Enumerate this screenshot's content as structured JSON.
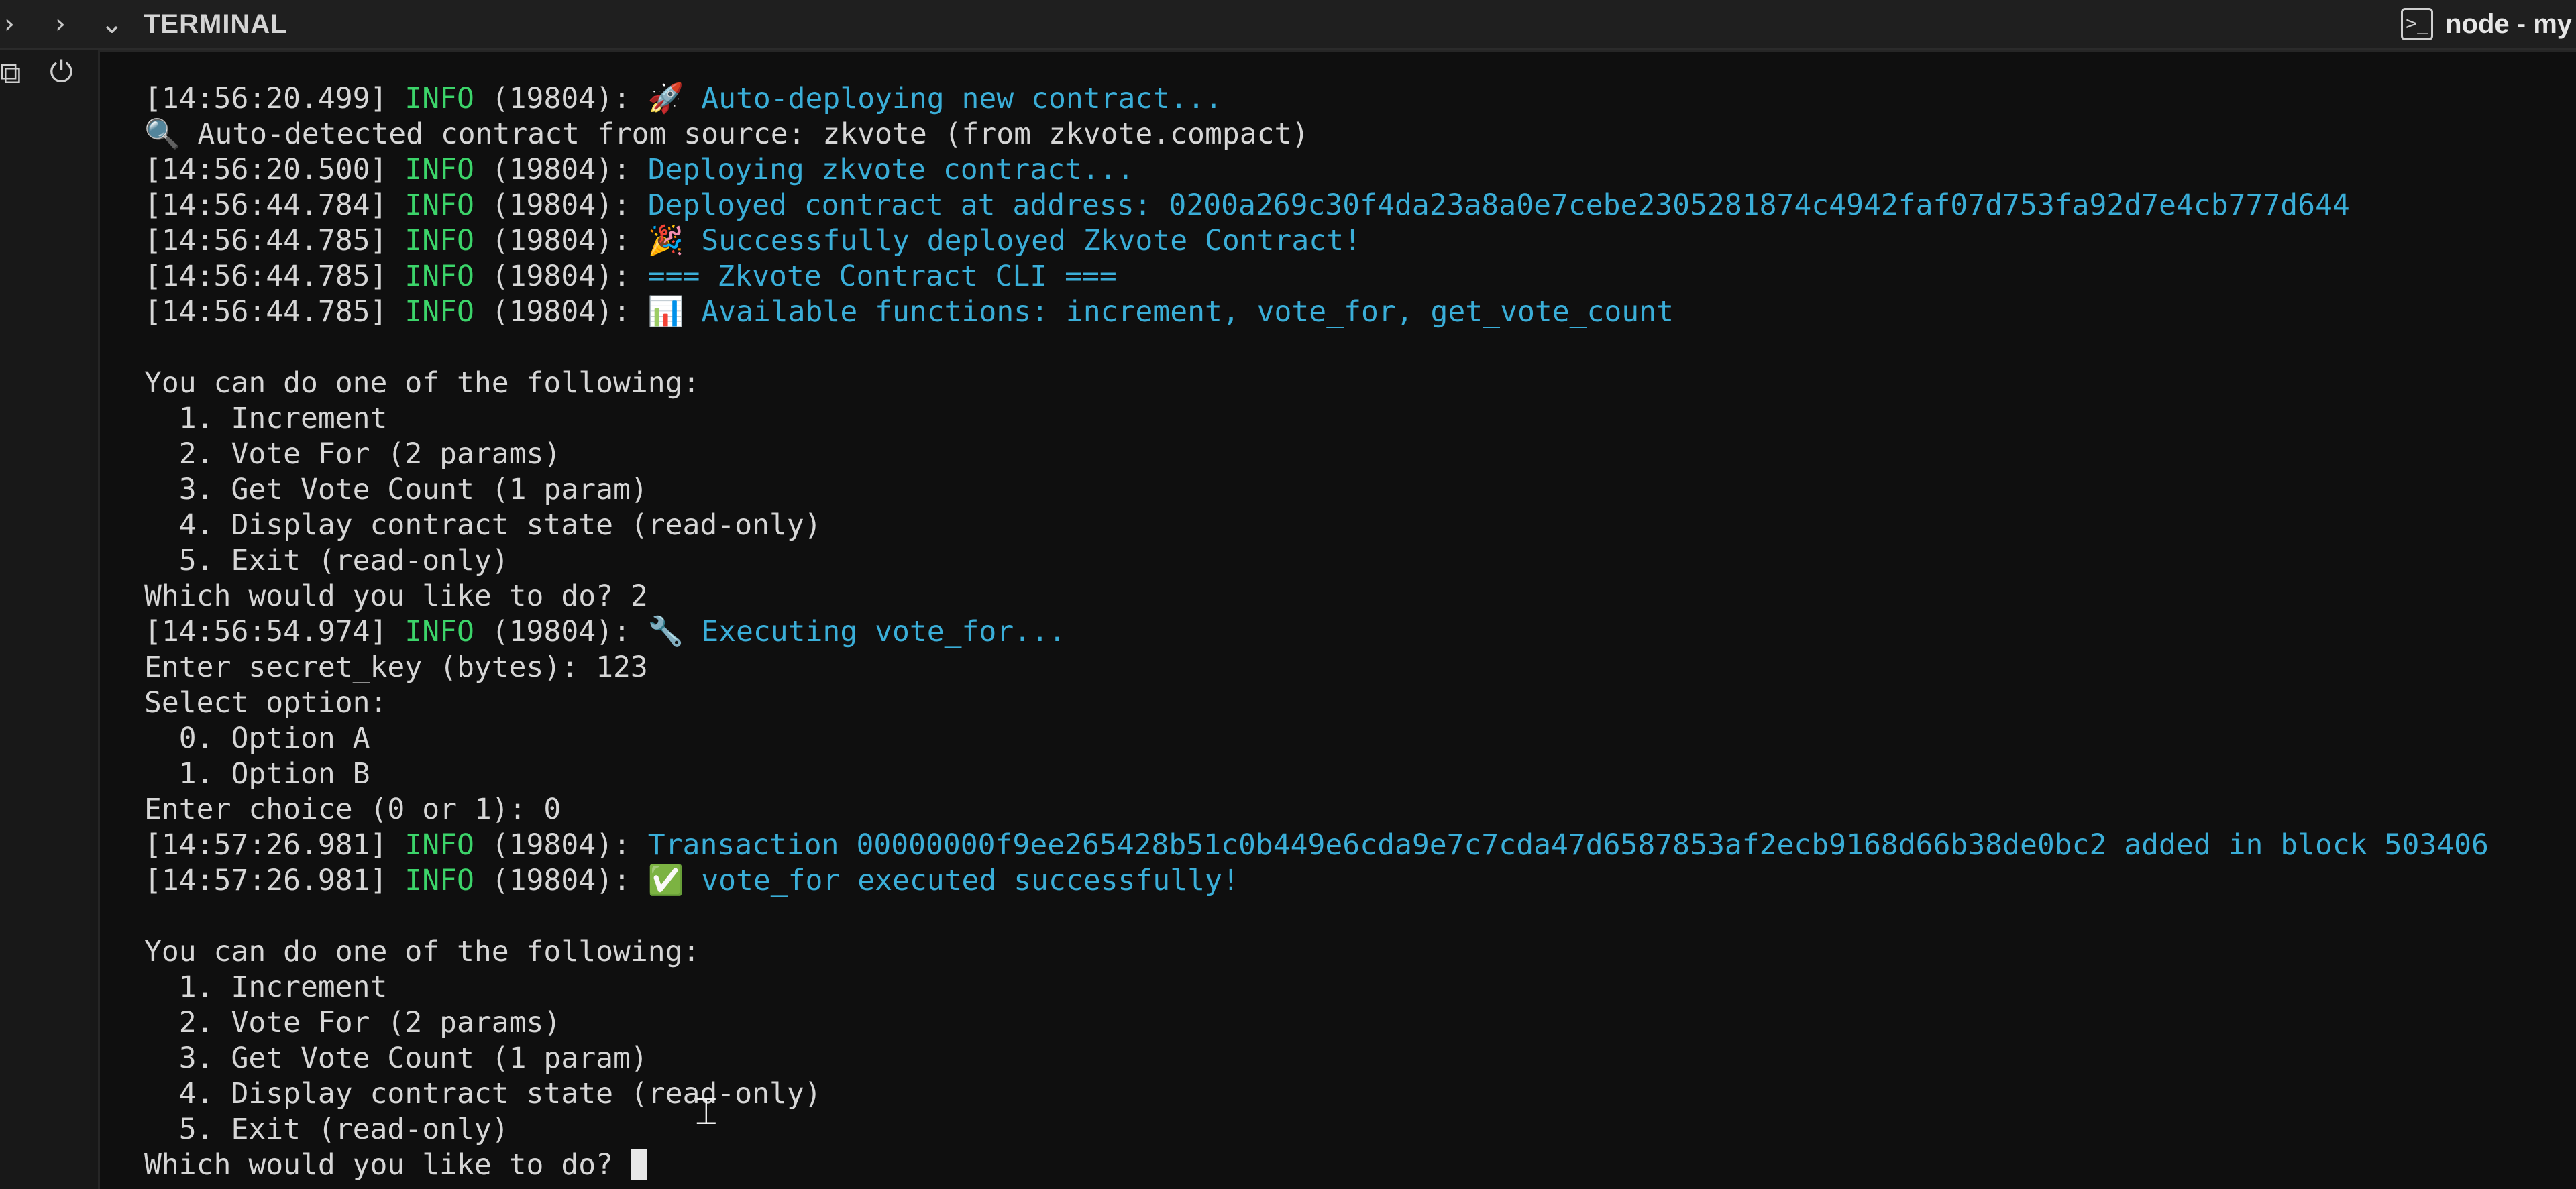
{
  "header": {
    "panel_title": "TERMINAL",
    "collapse_icon_1": "chevron-right-icon",
    "collapse_icon_2": "chevron-right-icon",
    "panel_toggle_icon": "chevron-down-icon",
    "tab": {
      "icon": "terminal-icon",
      "label": "node - my"
    }
  },
  "sidebar": {
    "icons": [
      "remote-explorer-icon",
      "plug-icon"
    ]
  },
  "colors": {
    "log_level": "#3cd46a",
    "log_message": "#3aaed8",
    "default_text": "#d6d6d6",
    "background": "#0f0f0f"
  },
  "terminal": {
    "lines": [
      {
        "ts": "[14:56:20.499]",
        "level": "INFO",
        "pid": "(19804):",
        "emoji": "🚀",
        "message": "Auto-deploying new contract..."
      },
      {
        "plain": "🔍 Auto-detected contract from source: zkvote (from zkvote.compact)"
      },
      {
        "ts": "[14:56:20.500]",
        "level": "INFO",
        "pid": "(19804):",
        "message": "Deploying zkvote contract..."
      },
      {
        "ts": "[14:56:44.784]",
        "level": "INFO",
        "pid": "(19804):",
        "message": "Deployed contract at address: 0200a269c30f4da23a8a0e7cebe2305281874c4942faf07d753fa92d7e4cb777d644"
      },
      {
        "ts": "[14:56:44.785]",
        "level": "INFO",
        "pid": "(19804):",
        "emoji": "🎉",
        "message": "Successfully deployed Zkvote Contract!"
      },
      {
        "ts": "[14:56:44.785]",
        "level": "INFO",
        "pid": "(19804):",
        "message": "=== Zkvote Contract CLI ==="
      },
      {
        "ts": "[14:56:44.785]",
        "level": "INFO",
        "pid": "(19804):",
        "emoji": "📊",
        "message": "Available functions: increment, vote_for, get_vote_count"
      },
      {
        "plain": ""
      },
      {
        "plain": "You can do one of the following:"
      },
      {
        "plain": "  1. Increment"
      },
      {
        "plain": "  2. Vote For (2 params)"
      },
      {
        "plain": "  3. Get Vote Count (1 param)"
      },
      {
        "plain": "  4. Display contract state (read-only)"
      },
      {
        "plain": "  5. Exit (read-only)"
      },
      {
        "plain": "Which would you like to do? 2"
      },
      {
        "ts": "[14:56:54.974]",
        "level": "INFO",
        "pid": "(19804):",
        "emoji": "🔧",
        "message": "Executing vote_for..."
      },
      {
        "plain": "Enter secret_key (bytes): 123"
      },
      {
        "plain": "Select option:"
      },
      {
        "plain": "  0. Option A"
      },
      {
        "plain": "  1. Option B"
      },
      {
        "plain": "Enter choice (0 or 1): 0"
      },
      {
        "ts": "[14:57:26.981]",
        "level": "INFO",
        "pid": "(19804):",
        "message": "Transaction 00000000f9ee265428b51c0b449e6cda9e7c7cda47d6587853af2ecb9168d66b38de0bc2 added in block 503406"
      },
      {
        "ts": "[14:57:26.981]",
        "level": "INFO",
        "pid": "(19804):",
        "emoji": "✅",
        "message": "vote_for executed successfully!"
      },
      {
        "plain": ""
      },
      {
        "plain": "You can do one of the following:"
      },
      {
        "plain": "  1. Increment"
      },
      {
        "plain": "  2. Vote For (2 params)"
      },
      {
        "plain": "  3. Get Vote Count (1 param)"
      },
      {
        "plain": "  4. Display contract state (read-only)"
      },
      {
        "plain": "  5. Exit (read-only)"
      }
    ],
    "prompt": "Which would you like to do? "
  }
}
